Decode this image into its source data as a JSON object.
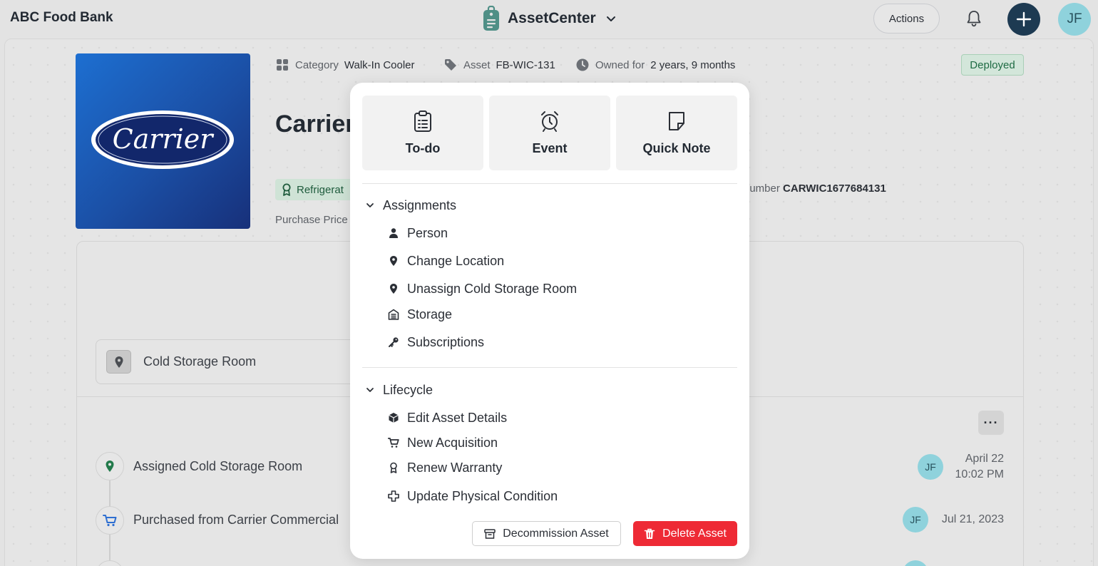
{
  "header": {
    "org_name": "ABC Food Bank",
    "app_name": "AssetCenter",
    "actions_label": "Actions",
    "user_initials": "JF"
  },
  "asset": {
    "logo_text": "Carrier",
    "category_label": "Category",
    "category_value": "Walk-In Cooler",
    "asset_label": "Asset",
    "asset_value": "FB-WIC-131",
    "owned_label": "Owned for",
    "owned_value": "2 years, 9 months",
    "status": "Deployed",
    "title": "Carrier",
    "category_chip": "Refrigerat",
    "serial_label": "lumber",
    "serial_value": "CARWIC1677684131",
    "purchase_price_label": "Purchase Price",
    "location": "Cold Storage Room",
    "more_label": "···"
  },
  "timeline": [
    {
      "text": "Assigned  Cold Storage Room",
      "initials": "JF",
      "date_line1": "April 22",
      "date_line2": "10:02 PM"
    },
    {
      "text": "Purchased from Carrier Commercial",
      "initials": "JF",
      "date_line1": "Jul 21, 2023",
      "date_line2": ""
    }
  ],
  "popover": {
    "quick_actions": [
      {
        "label": "To-do",
        "icon": "clipboard-icon"
      },
      {
        "label": "Event",
        "icon": "alarm-clock-icon"
      },
      {
        "label": "Quick Note",
        "icon": "note-icon"
      }
    ],
    "sections": [
      {
        "title": "Assignments",
        "items": [
          {
            "label": "Person",
            "icon": "person-icon"
          },
          {
            "label": "Change Location",
            "icon": "location-pin-icon"
          },
          {
            "label": "Unassign Cold Storage Room",
            "icon": "location-pin-icon"
          },
          {
            "label": "Storage",
            "icon": "storage-icon"
          },
          {
            "label": "Subscriptions",
            "icon": "key-icon"
          }
        ]
      },
      {
        "title": "Lifecycle",
        "items": [
          {
            "label": "Edit Asset Details",
            "icon": "cube-icon"
          },
          {
            "label": "New Acquisition",
            "icon": "cart-icon"
          },
          {
            "label": "Renew Warranty",
            "icon": "ribbon-icon"
          },
          {
            "label": "Update Physical Condition",
            "icon": "medical-cross-icon"
          }
        ]
      }
    ],
    "decommission_label": "Decommission Asset",
    "delete_label": "Delete Asset"
  },
  "colors": {
    "plus_button": "#1d3a52",
    "avatar": "#8fd2dc",
    "deployed_bg": "#d3e6da",
    "delete_red": "#ee2a35",
    "logo_blue": "#1b4fa5"
  }
}
